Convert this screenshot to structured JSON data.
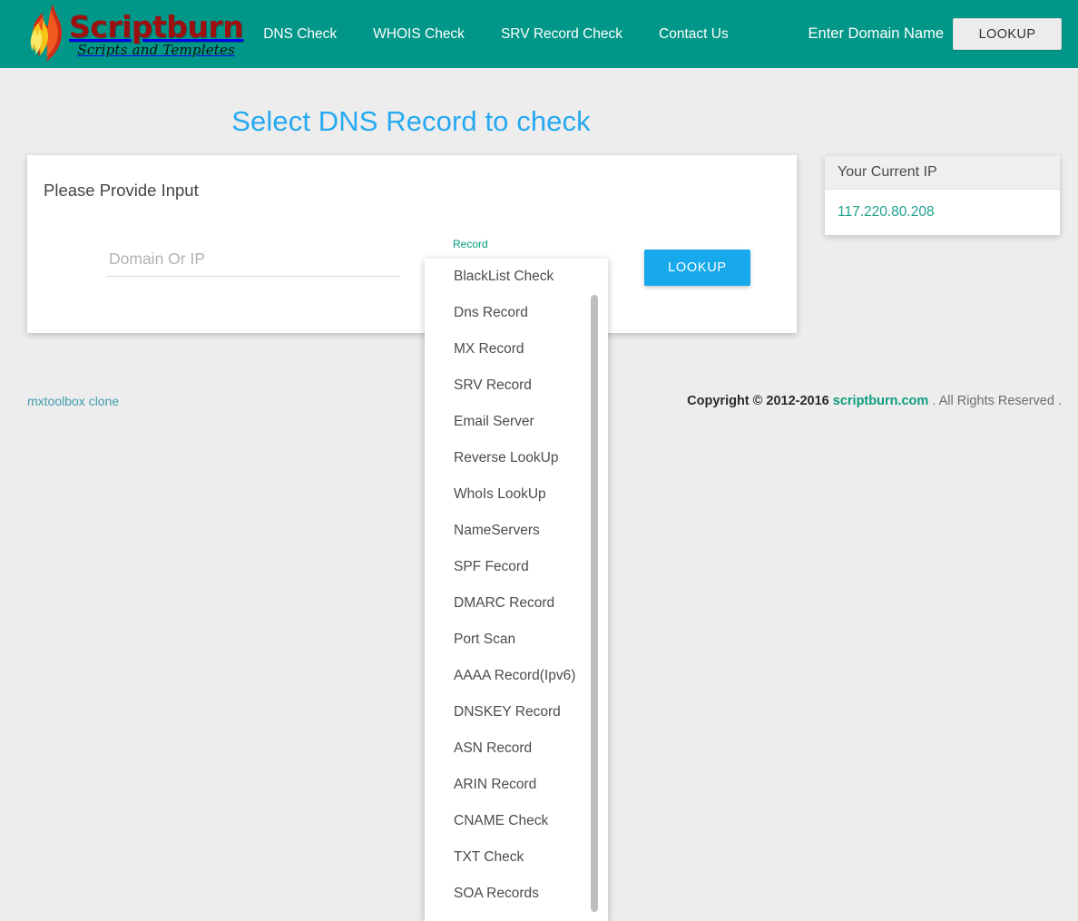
{
  "header": {
    "brand": {
      "name": "Scriptburn",
      "tagline": "Scripts and Templetes",
      "flame_icon": "flame-icon"
    },
    "nav": [
      {
        "label": "DNS Check"
      },
      {
        "label": "WHOIS Check"
      },
      {
        "label": "SRV Record Check"
      },
      {
        "label": "Contact Us"
      }
    ],
    "domain_input": {
      "value": "",
      "placeholder": "Enter Domain Name"
    },
    "lookup_button": "LOOKUP",
    "background_color": "#009688"
  },
  "page": {
    "title": "Select DNS Record to check",
    "title_color": "#26a9f0",
    "background_color": "#ededed"
  },
  "input_card": {
    "title": "Please Provide Input",
    "domain_field": {
      "value": "",
      "placeholder": "Domain Or IP"
    },
    "record_field": {
      "label": "Record",
      "label_color": "#009a7a",
      "selected": ""
    },
    "lookup_button": "LOOKUP",
    "lookup_button_color": "#18a9ed"
  },
  "record_dropdown": {
    "open": true,
    "options": [
      "BlackList Check",
      "Dns Record",
      "MX Record",
      "SRV Record",
      "Email Server",
      "Reverse LookUp",
      "WhoIs LookUp",
      "NameServers",
      "SPF Fecord",
      "DMARC Record",
      "Port Scan",
      "AAAA Record(Ipv6)",
      "DNSKEY Record",
      "ASN Record",
      "ARIN Record",
      "CNAME Check",
      "TXT Check",
      "SOA Records"
    ]
  },
  "ip_card": {
    "header": "Your Current IP",
    "ip": "117.220.80.208",
    "ip_color": "#1fa08c"
  },
  "footer": {
    "left_link": "mxtoolbox clone",
    "left_link_color": "#3f9cad",
    "copyright_prefix": "Copyright © 2012-2016",
    "copyright_brand": "scriptburn.com",
    "copyright_suffix": ". All Rights Reserved ."
  }
}
